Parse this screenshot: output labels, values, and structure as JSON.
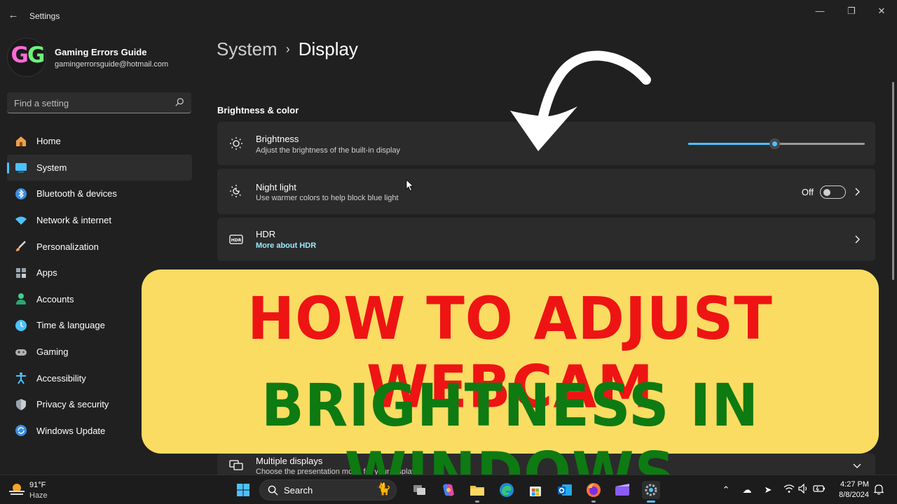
{
  "window": {
    "title": "Settings",
    "controls": [
      "minimize",
      "maximize",
      "close"
    ]
  },
  "user": {
    "initials": "GG",
    "name": "Gaming Errors Guide",
    "email": "gamingerrorsguide@hotmail.com"
  },
  "search": {
    "placeholder": "Find a setting"
  },
  "sidebar": {
    "items": [
      {
        "label": "Home",
        "icon": "home-icon",
        "color": "#f0a04b"
      },
      {
        "label": "System",
        "icon": "system-icon",
        "color": "#4cc2ff",
        "active": true
      },
      {
        "label": "Bluetooth & devices",
        "icon": "bluetooth-icon",
        "color": "#3a8ee6"
      },
      {
        "label": "Network & internet",
        "icon": "wifi-icon",
        "color": "#4cc2ff"
      },
      {
        "label": "Personalization",
        "icon": "brush-icon",
        "color": "#f2a35b"
      },
      {
        "label": "Apps",
        "icon": "apps-icon",
        "color": "#9aa3ad"
      },
      {
        "label": "Accounts",
        "icon": "accounts-icon",
        "color": "#3ecf8e"
      },
      {
        "label": "Time & language",
        "icon": "globe-clock-icon",
        "color": "#4cc2ff"
      },
      {
        "label": "Gaming",
        "icon": "gamepad-icon",
        "color": "#b0b0b0"
      },
      {
        "label": "Accessibility",
        "icon": "accessibility-icon",
        "color": "#4cc2ff"
      },
      {
        "label": "Privacy & security",
        "icon": "shield-icon",
        "color": "#9aa3ad"
      },
      {
        "label": "Windows Update",
        "icon": "update-icon",
        "color": "#4cc2ff"
      }
    ]
  },
  "breadcrumb": {
    "parent": "System",
    "separator": "›",
    "current": "Display"
  },
  "section": {
    "title": "Brightness & color"
  },
  "cards": {
    "brightness": {
      "title": "Brightness",
      "subtitle": "Adjust the brightness of the built-in display",
      "level": 0.49
    },
    "night_light": {
      "title": "Night light",
      "subtitle": "Use warmer colors to help block blue light",
      "state": "Off"
    },
    "hdr": {
      "title": "HDR",
      "link": "More about HDR"
    },
    "multiple_displays": {
      "title": "Multiple displays",
      "subtitle": "Choose the presentation mode for your displays"
    }
  },
  "banner": {
    "line1": "HOW TO ADJUST WEBCAM",
    "line2": "BRIGHTNESS IN WINDOWS",
    "line1_color": "#ee1414",
    "line2_color": "#0e7a12",
    "background": "#fbdc62"
  },
  "taskbar": {
    "weather": {
      "temp": "91°F",
      "desc": "Haze"
    },
    "search_label": "Search",
    "apps": [
      "start-icon",
      "task-view-icon",
      "copilot-icon",
      "file-explorer-icon",
      "edge-icon",
      "store-icon",
      "outlook-icon",
      "firefox-icon",
      "clipchamp-icon",
      "settings-icon"
    ],
    "clock": {
      "time": "4:27 PM",
      "date": "8/8/2024"
    }
  },
  "accent": "#4cc2ff"
}
